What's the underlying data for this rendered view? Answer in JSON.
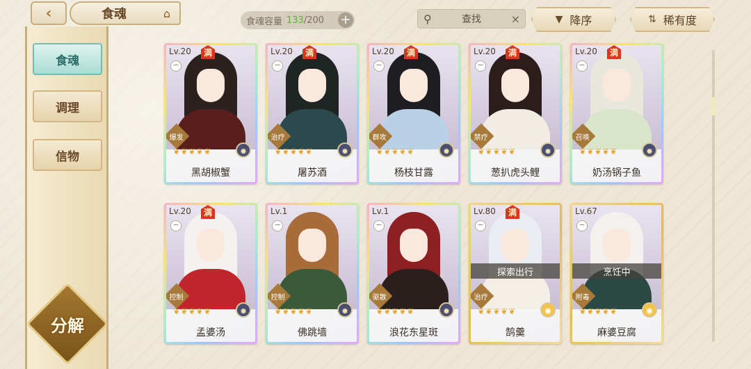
{
  "header": {
    "back_icon": "chevron-left-icon",
    "title": "食魂",
    "home_icon": "house-icon",
    "capacity_label": "食魂容量",
    "capacity_current": "133",
    "capacity_total": "/200",
    "capacity_add": "+",
    "search_label": "查找",
    "search_clear": "×",
    "sort_desc_label": "降序",
    "sort_desc_icon": "▼",
    "sort_rarity_label": "稀有度",
    "sort_rarity_icon": "⇅"
  },
  "sidebar": {
    "items": [
      {
        "label": "食魂",
        "active": true
      },
      {
        "label": "调理",
        "active": false
      },
      {
        "label": "信物",
        "active": false
      }
    ],
    "decompose_label": "分解"
  },
  "cards": [
    {
      "level": "Lv.20",
      "full": "满",
      "role": "爆发",
      "name": "黑胡椒蟹",
      "stars": 5,
      "element": "moon",
      "status": ""
    },
    {
      "level": "Lv.20",
      "full": "满",
      "role": "治疗",
      "name": "屠苏酒",
      "stars": 5,
      "element": "moon",
      "status": ""
    },
    {
      "level": "Lv.20",
      "full": "满",
      "role": "群攻",
      "name": "杨枝甘露",
      "stars": 5,
      "element": "moon",
      "status": ""
    },
    {
      "level": "Lv.20",
      "full": "满",
      "role": "禁疗",
      "name": "葱扒虎头鲤",
      "stars": 5,
      "element": "moon",
      "status": ""
    },
    {
      "level": "Lv.20",
      "full": "满",
      "role": "召唤",
      "name": "奶汤锅子鱼",
      "stars": 5,
      "element": "moon",
      "status": ""
    },
    {
      "level": "Lv.20",
      "full": "满",
      "role": "控制",
      "name": "孟婆汤",
      "stars": 5,
      "element": "moon",
      "status": ""
    },
    {
      "level": "Lv.1",
      "full": "",
      "role": "控制",
      "name": "佛跳墙",
      "stars": 5,
      "element": "moon",
      "status": ""
    },
    {
      "level": "Lv.1",
      "full": "",
      "role": "驱散",
      "name": "浪花东星斑",
      "stars": 5,
      "element": "moon",
      "status": ""
    },
    {
      "level": "Lv.80",
      "full": "满",
      "role": "治疗",
      "name": "鹄羹",
      "stars": 5,
      "element": "sun",
      "status": "探索出行"
    },
    {
      "level": "Lv.67",
      "full": "",
      "role": "附毒",
      "name": "麻婆豆腐",
      "stars": 5,
      "element": "sun",
      "status": "烹饪中"
    }
  ]
}
